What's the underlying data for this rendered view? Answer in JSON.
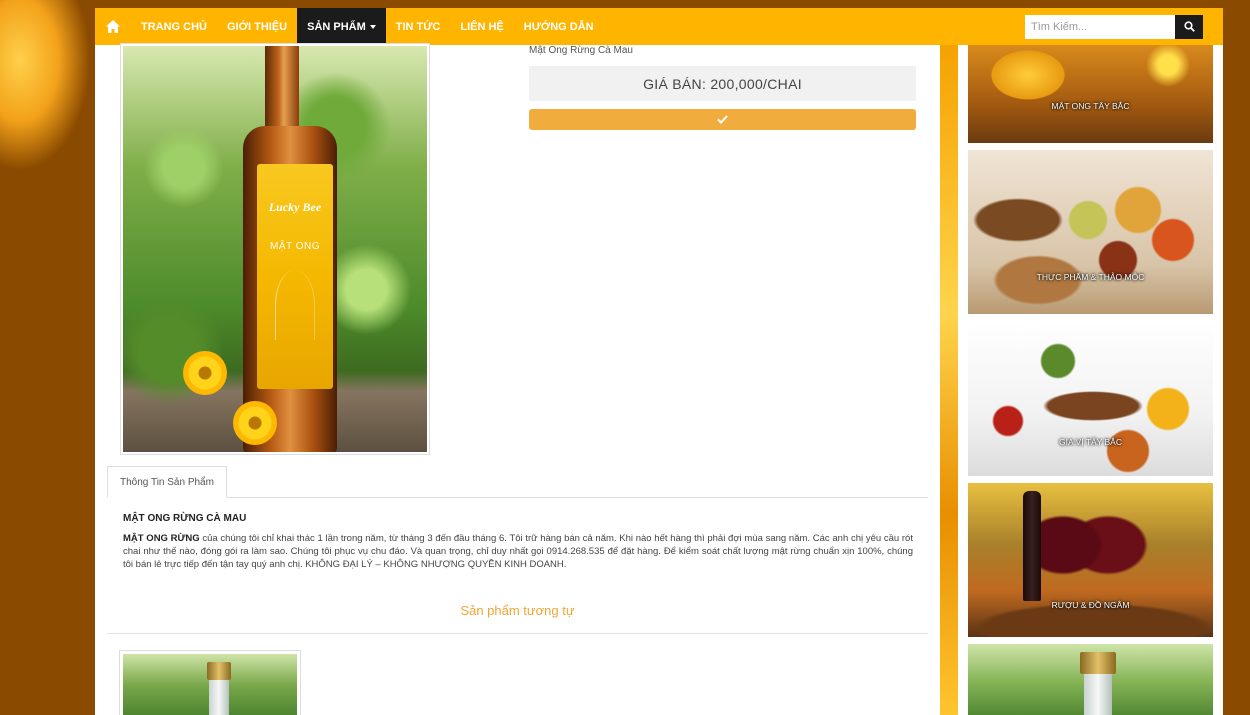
{
  "nav": {
    "items": [
      {
        "label": "TRANG CHỦ"
      },
      {
        "label": "GIỚI THIỆU"
      },
      {
        "label": "SẢN PHẨM"
      },
      {
        "label": "TIN TỨC"
      },
      {
        "label": "LIÊN HỆ"
      },
      {
        "label": "HƯỚNG DẪN"
      }
    ],
    "search_placeholder": "Tìm Kiếm..."
  },
  "product": {
    "name": "Mật Ong Rừng Cà Mau",
    "price": "GIÁ BÁN: 200,000/CHAI",
    "bottle_brand": "Lucky Bee",
    "bottle_name": "MẬT ONG"
  },
  "tabs": [
    {
      "label": "Thông Tin Sản Phẩm"
    }
  ],
  "description": {
    "title": "MẬT ONG RỪNG CÀ MAU",
    "lead": "MẬT ONG RỪNG",
    "body": " của chúng tôi chỉ khai thác 1 lần trong năm, từ tháng 3 đến đầu tháng 6. Tôi trữ hàng bán cả năm. Khi nào hết hàng thì phải đợi mùa sang năm. Các anh chị yêu cầu rót chai như thế nào, đóng gói ra làm sao. Chúng tôi phục vụ chu đáo. Và quan trọng, chỉ duy nhất gọi 0914.268.535 để đặt hàng. Để kiểm soát chất lượng mật rừng chuẩn xịn 100%, chúng tôi bán lẻ trực tiếp đến tận tay quý anh chị. KHÔNG ĐẠI LÝ – KHÔNG NHƯỢNG QUYỀN KINH DOANH."
  },
  "related": {
    "title": "Sản phẩm tương tự"
  },
  "sidebar": {
    "cards": [
      {
        "label": "MẬT ONG TÂY BẮC"
      },
      {
        "label": "THỰC PHẨM & THẢO MỘC"
      },
      {
        "label": "GIA VỊ TÂY BẮC"
      },
      {
        "label": "RƯỢU & ĐỒ NGÂM"
      }
    ]
  },
  "colors": {
    "nav_bg": "#ffb400",
    "nav_active_bg": "#1b1b1b",
    "accent_button": "#f0ac3c",
    "related_title": "#f0a534"
  },
  "icons": {
    "home": "home-icon",
    "search": "search-icon",
    "check": "check-icon",
    "dropdown": "caret-down-icon"
  }
}
